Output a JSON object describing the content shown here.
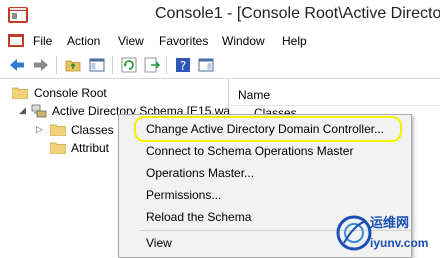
{
  "window": {
    "title": "Console1 - [Console Root\\Active Directory"
  },
  "menu": [
    "File",
    "Action",
    "View",
    "Favorites",
    "Window",
    "Help"
  ],
  "columns": {
    "name": "Name"
  },
  "right_items": [
    "Classes"
  ],
  "tree": {
    "root": "Console Root",
    "schema": "Active Directory Schema [E15.wa",
    "classes": "Classes",
    "attributes": "Attribut"
  },
  "context_menu": [
    "Change Active Directory Domain Controller...",
    "Connect to Schema Operations Master",
    "Operations Master...",
    "Permissions...",
    "Reload the Schema",
    "View"
  ],
  "watermark": {
    "line1": "运维网",
    "line2": "iyunv.com"
  },
  "colors": {
    "highlight": "#f2f200",
    "accent": "#1a4fb3"
  }
}
